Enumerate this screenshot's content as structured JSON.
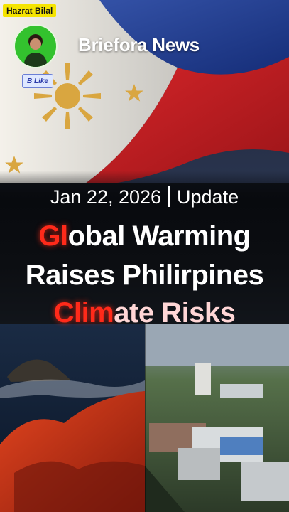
{
  "channel_tag": "Hazrat Bilal",
  "brand": "Briefora News",
  "like_label": "B Like",
  "dateline": {
    "date": "Jan 22, 2026",
    "label": "Update"
  },
  "headline": {
    "line1_accent": "Gl",
    "line1_rest": "obal Warming",
    "line2": "Raises Philirpines",
    "line3_accent": "Clim",
    "line3_rest": "ate Risks"
  },
  "colors": {
    "accent_red": "#ff2a1a",
    "flag_blue": "#1f3c8f",
    "flag_red": "#c61f24",
    "sun_gold": "#d9a640",
    "tag_yellow": "#f5e400"
  },
  "icons": [
    "avatar",
    "sun-icon",
    "star-icon"
  ]
}
